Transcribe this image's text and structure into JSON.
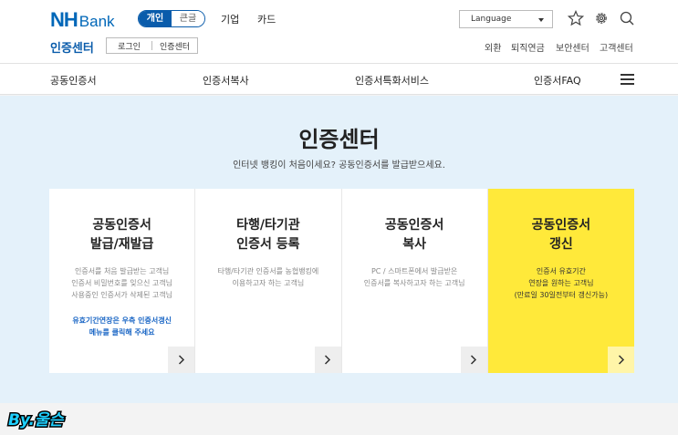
{
  "header": {
    "logo_nh": "NH",
    "logo_bank": "Bank",
    "segment": [
      "개인",
      "큰글"
    ],
    "gnav": [
      "기업",
      "카드"
    ],
    "language": "Language",
    "center_title": "인증센터",
    "login": "로그인",
    "cert_center": "인증센터",
    "util": [
      "외환",
      "퇴직연금",
      "보안센터",
      "고객센터"
    ]
  },
  "nav": [
    "공동인증서",
    "인증서복사",
    "인증서특화서비스",
    "인증서FAQ"
  ],
  "hero": {
    "title": "인증센터",
    "subtitle": "인터넷 뱅킹이 처음이세요? 공동인증서를 발급받으세요."
  },
  "cards": [
    {
      "title": [
        "공동인증서",
        "발급/재발급"
      ],
      "desc": [
        "인증서를 처음 발급받는 고객님",
        "인증서 비밀번호를 잊으신 고객님",
        "사용중인 인증서가 삭제된 고객님"
      ],
      "note": [
        "유효기간연장은 우측 인증서갱신",
        "메뉴를 클릭해 주세요"
      ]
    },
    {
      "title": [
        "타행/타기관",
        "인증서 등록"
      ],
      "desc": [
        "타행/타기관 인증서를 농협뱅킹에",
        "이용하고자 하는 고객님"
      ],
      "note": []
    },
    {
      "title": [
        "공동인증서",
        "복사"
      ],
      "desc": [
        "PC / 스마트폰에서 발급받은",
        "인증서를 복사하고자 하는 고객님"
      ],
      "note": []
    },
    {
      "title": [
        "공동인증서",
        "갱신"
      ],
      "desc": [
        "인증서 유효기간",
        "연장을 원하는 고객님",
        "(만료일 30일전부터 갱신가능)"
      ],
      "note": []
    }
  ],
  "colors": {
    "brand": "#0067b8",
    "highlight": "#ffe93a",
    "hero_bg": "#e4f1fa"
  },
  "watermark": "By.울슨"
}
